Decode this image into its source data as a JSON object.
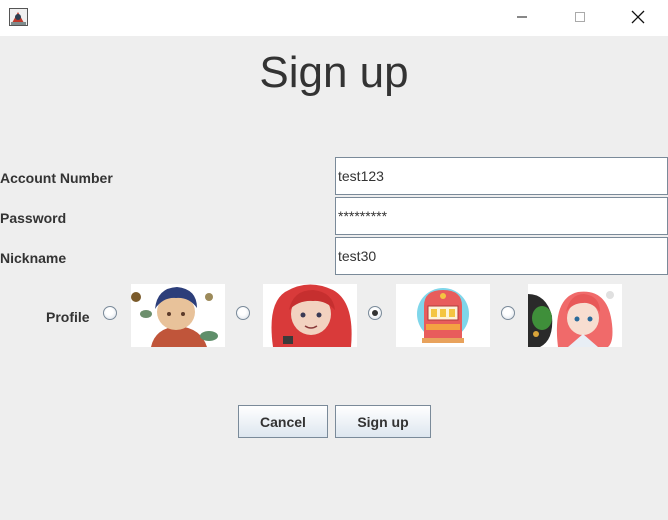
{
  "window": {
    "title": ""
  },
  "heading": "Sign up",
  "form": {
    "account_number": {
      "label": "Account Number",
      "value": "test123"
    },
    "password": {
      "label": "Password",
      "value": "*********"
    },
    "nickname": {
      "label": "Nickname",
      "value": "test30"
    },
    "profile": {
      "label": "Profile",
      "options": [
        "boy-avatar",
        "red-hair-girl-avatar",
        "slot-machine-avatar",
        "pink-hair-girl-avatar"
      ],
      "selected_index": 2
    }
  },
  "buttons": {
    "cancel": "Cancel",
    "signup": "Sign up"
  },
  "colors": {
    "background": "#eeeeee",
    "titlebar": "#ffffff",
    "border": "#7a8a99",
    "text": "#333333"
  }
}
